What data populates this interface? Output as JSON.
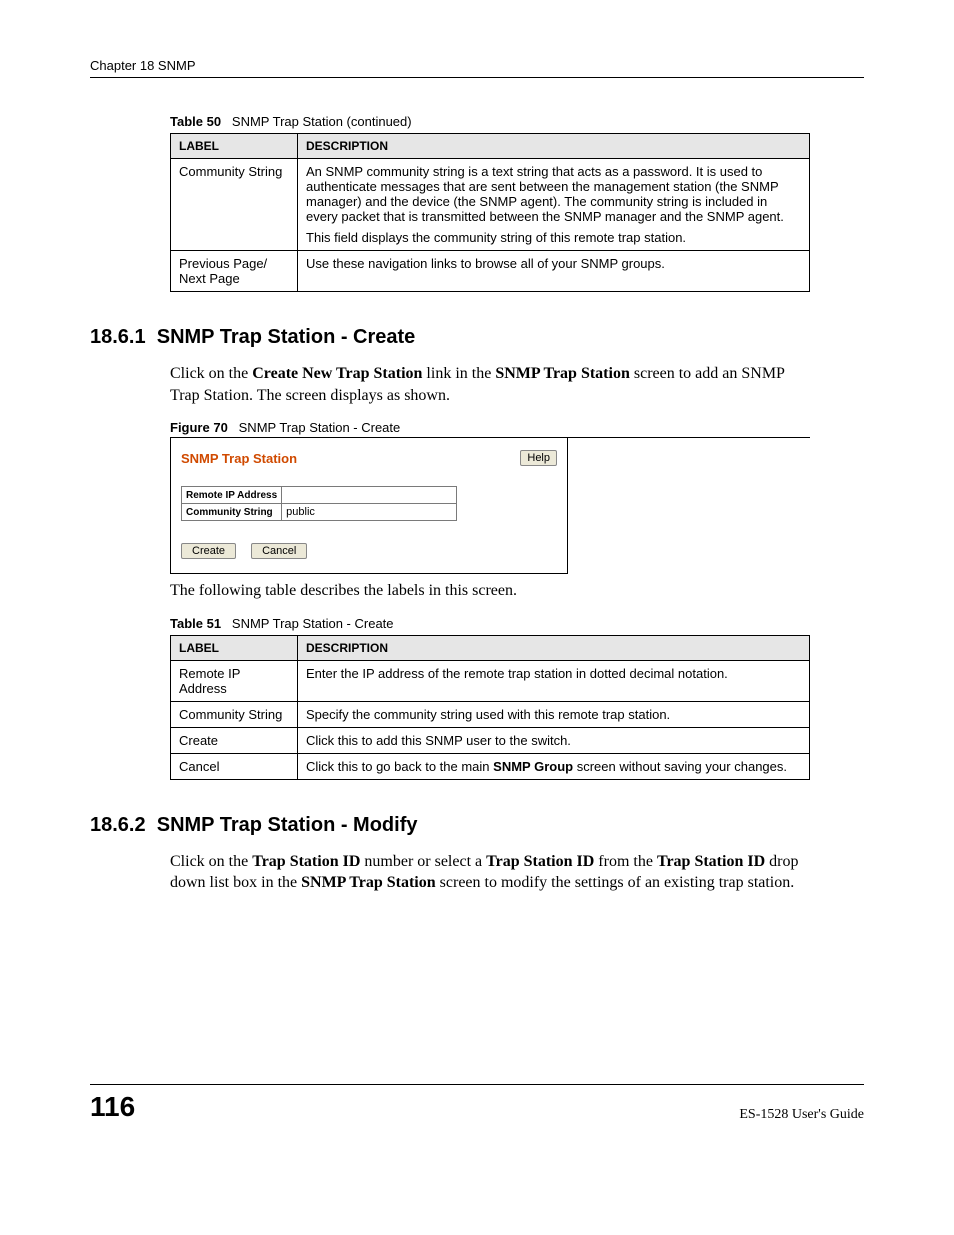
{
  "header": {
    "chapter": "Chapter 18 SNMP"
  },
  "table50": {
    "caption_prefix": "Table 50",
    "caption_title": "SNMP Trap Station  (continued)",
    "headers": [
      "LABEL",
      "DESCRIPTION"
    ],
    "rows": [
      {
        "label": "Community String",
        "desc": "An SNMP community string is a text string that acts as a password. It is used to authenticate messages that are sent between the management station (the SNMP manager) and the device (the SNMP agent). The community string is included in every packet that is transmitted between the SNMP manager and the SNMP agent.",
        "desc2": "This field displays the community string of this remote trap station."
      },
      {
        "label": "Previous Page/ Next Page",
        "desc": "Use these navigation links to browse all of your SNMP groups."
      }
    ]
  },
  "section1": {
    "number": "18.6.1",
    "title": "SNMP Trap Station - Create",
    "p1_pre": "Click on the ",
    "p1_b1": "Create New Trap Station",
    "p1_mid": " link in the ",
    "p1_b2": "SNMP Trap Station",
    "p1_post": " screen to add an SNMP Trap Station. The screen displays as shown."
  },
  "figure70": {
    "caption_prefix": "Figure 70",
    "caption_title": "SNMP Trap Station - Create",
    "panel_title": "SNMP Trap Station",
    "help": "Help",
    "row1_label": "Remote IP Address",
    "row1_value": "",
    "row2_label": "Community String",
    "row2_value": "public",
    "create": "Create",
    "cancel": "Cancel"
  },
  "table51_intro": "The following table describes the labels in this screen.",
  "table51": {
    "caption_prefix": "Table 51",
    "caption_title": "SNMP Trap Station - Create",
    "headers": [
      "LABEL",
      "DESCRIPTION"
    ],
    "rows": [
      {
        "label": "Remote IP Address",
        "desc": "Enter the IP address of the remote trap station in dotted decimal notation."
      },
      {
        "label": "Community String",
        "desc": "Specify the community string used with this remote trap station."
      },
      {
        "label": "Create",
        "desc": "Click this to add this SNMP user to the switch."
      },
      {
        "label": "Cancel",
        "desc_pre": "Click this to go back to the main ",
        "desc_b": "SNMP Group",
        "desc_post": " screen without saving your changes."
      }
    ]
  },
  "section2": {
    "number": "18.6.2",
    "title": "SNMP Trap Station - Modify",
    "p_pre": "Click on the ",
    "p_b1": "Trap Station ID",
    "p_mid1": " number or select a ",
    "p_b2": "Trap Station ID",
    "p_mid2": " from the ",
    "p_b3": "Trap Station ID",
    "p_mid3": " drop down list box in the ",
    "p_b4": "SNMP Trap Station",
    "p_post": " screen to modify the settings of an existing trap station."
  },
  "footer": {
    "page": "116",
    "guide": "ES-1528 User's Guide"
  }
}
